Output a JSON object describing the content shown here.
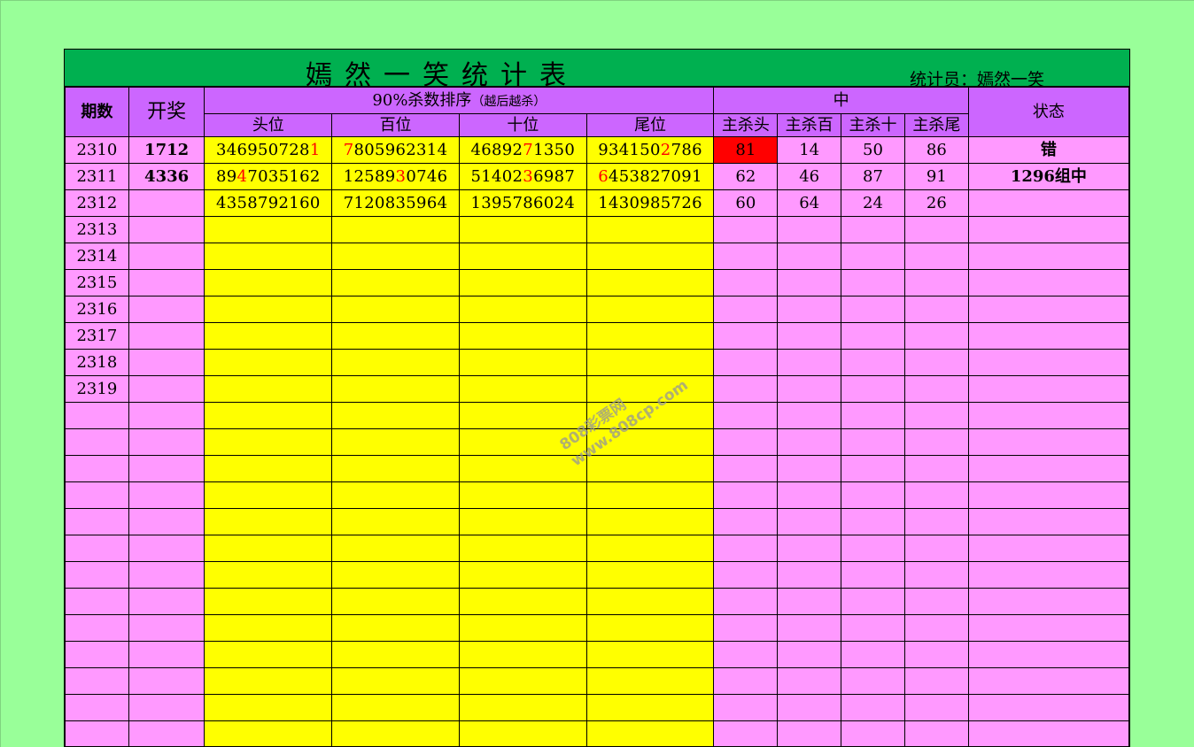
{
  "header": {
    "title": "嫣然一笑统计表",
    "statistician": "统计员：嫣然一笑"
  },
  "columns": {
    "issue": "期数",
    "draw": "开奖",
    "kill_sort": "90%杀数排序",
    "kill_sort_note": "（越后越杀）",
    "positions": [
      "头位",
      "百位",
      "十位",
      "尾位"
    ],
    "hit_group": "中",
    "main_kill": [
      "主杀头",
      "主杀百",
      "主杀十",
      "主杀尾"
    ],
    "status": "状态"
  },
  "rows": [
    {
      "issue": "2310",
      "draw": "1712",
      "seqs": [
        {
          "pre": "346950728",
          "hl": "1",
          "post": ""
        },
        {
          "pre": "",
          "hl": "7",
          "post": "805962314"
        },
        {
          "pre": "46892",
          "hl": "7",
          "post": "1350"
        },
        {
          "pre": "934150",
          "hl": "2",
          "post": "786"
        }
      ],
      "kills": [
        "81",
        "14",
        "50",
        "86"
      ],
      "status": "错"
    },
    {
      "issue": "2311",
      "draw": "4336",
      "seqs": [
        {
          "pre": "89",
          "hl": "4",
          "post": "7035162"
        },
        {
          "pre": "12589",
          "hl": "3",
          "post": "0746"
        },
        {
          "pre": "51402",
          "hl": "3",
          "post": "6987"
        },
        {
          "pre": "",
          "hl": "6",
          "post": "453827091"
        }
      ],
      "kills": [
        "62",
        "46",
        "87",
        "91"
      ],
      "status": "1296组中"
    },
    {
      "issue": "2312",
      "draw": "",
      "seqs": [
        {
          "pre": "4358792160",
          "hl": "",
          "post": ""
        },
        {
          "pre": "7120835964",
          "hl": "",
          "post": ""
        },
        {
          "pre": "1395786024",
          "hl": "",
          "post": ""
        },
        {
          "pre": "1430985726",
          "hl": "",
          "post": ""
        }
      ],
      "kills": [
        "60",
        "64",
        "24",
        "26"
      ],
      "status": ""
    }
  ],
  "future_issues": [
    "2313",
    "2314",
    "2315",
    "2316",
    "2317",
    "2318",
    "2319"
  ],
  "blank_row_count": 13,
  "watermark": {
    "line1": "808彩票网",
    "line2": "www.808cp.com"
  },
  "colors": {
    "background": "#99ff99",
    "title_bar": "#00b050",
    "header": "#cc66ff",
    "row_pink": "#ff99ff",
    "sequence_yellow": "#ffff00",
    "highlight_red": "#ff0000",
    "issue_blue": "#3366ff"
  }
}
